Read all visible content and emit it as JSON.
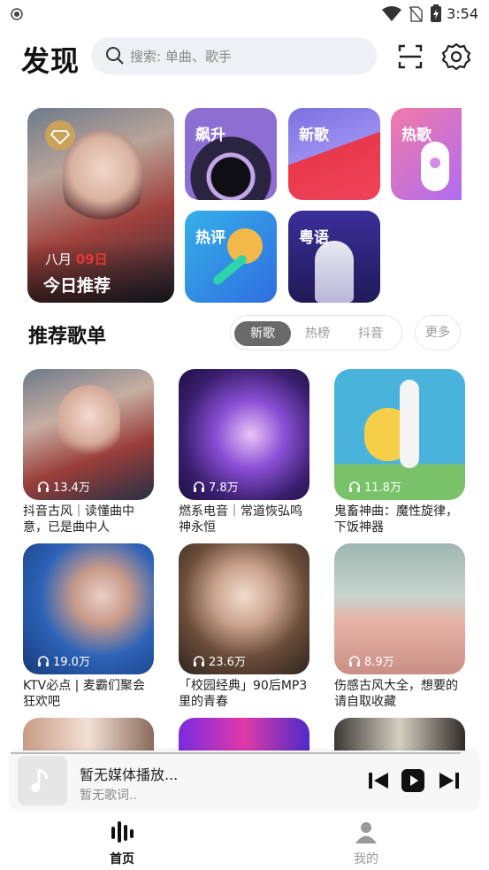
{
  "status": {
    "time": "3:54"
  },
  "header": {
    "title": "发现",
    "search_placeholder": "搜索: 单曲、歌手"
  },
  "tiles": {
    "daily": {
      "month": "八月",
      "day": "09日",
      "label": "今日推荐"
    },
    "soaring": "飙升",
    "new_songs": "新歌",
    "hot_songs": "热歌",
    "hot_comments": "热评",
    "cantonese": "粤语"
  },
  "section": {
    "title": "推荐歌单",
    "tabs": [
      "新歌",
      "热榜",
      "抖音"
    ],
    "more": "更多"
  },
  "playlists": [
    {
      "count": "13.4万",
      "name": "抖音古风｜读懂曲中意，已是曲中人"
    },
    {
      "count": "7.8万",
      "name": "燃系电音｜常道恢弘鸣神永恒"
    },
    {
      "count": "11.8万",
      "name": "鬼畜神曲：魔性旋律，下饭神器"
    },
    {
      "count": "19.0万",
      "name": "KTV必点 | 麦霸们聚会狂欢吧"
    },
    {
      "count": "23.6万",
      "name": "「校园经典」90后MP3里的青春"
    },
    {
      "count": "8.9万",
      "name": "伤感古风大全，想要的请自取收藏"
    }
  ],
  "player": {
    "title": "暂无媒体播放...",
    "lyrics": "暂无歌词.."
  },
  "nav": {
    "home": "首页",
    "mine": "我的"
  },
  "colors": {
    "accent": "#e53935",
    "tab_active": "#6a6a6a"
  }
}
